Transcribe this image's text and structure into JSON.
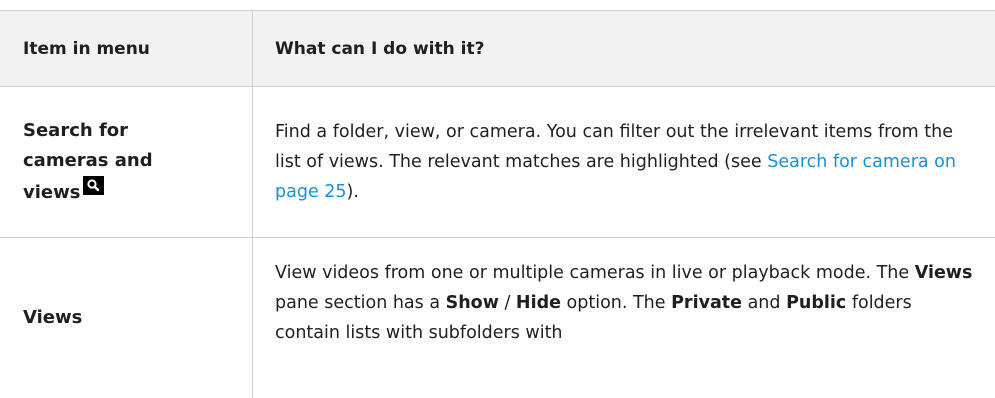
{
  "table": {
    "headers": {
      "item": "Item in menu",
      "desc": "What can I do with it?"
    },
    "rows": [
      {
        "item_line1": "Search for",
        "item_line2": "cameras and",
        "item_line3": "views",
        "icon": "search-icon",
        "desc_part1": "Find a folder, view, or camera. You can filter out the irrelevant items from the list of views. The relevant matches are highlighted (see ",
        "link_text": "Search for camera on page 25",
        "desc_part2": ")."
      },
      {
        "item": "Views",
        "desc_a": "View videos from one or multiple cameras in live or playback mode. The ",
        "bold_views": "Views",
        "desc_b": " pane section has a ",
        "bold_show": "Show",
        "desc_c": " / ",
        "bold_hide": "Hide",
        "desc_d": " option. The ",
        "bold_private": "Private",
        "desc_e": " and ",
        "bold_public": "Public",
        "desc_f": " folders contain lists with subfolders with"
      }
    ]
  },
  "colors": {
    "link": "#1a8fd6",
    "header_bg": "#f2f2f2",
    "border": "#cfcfcf"
  }
}
